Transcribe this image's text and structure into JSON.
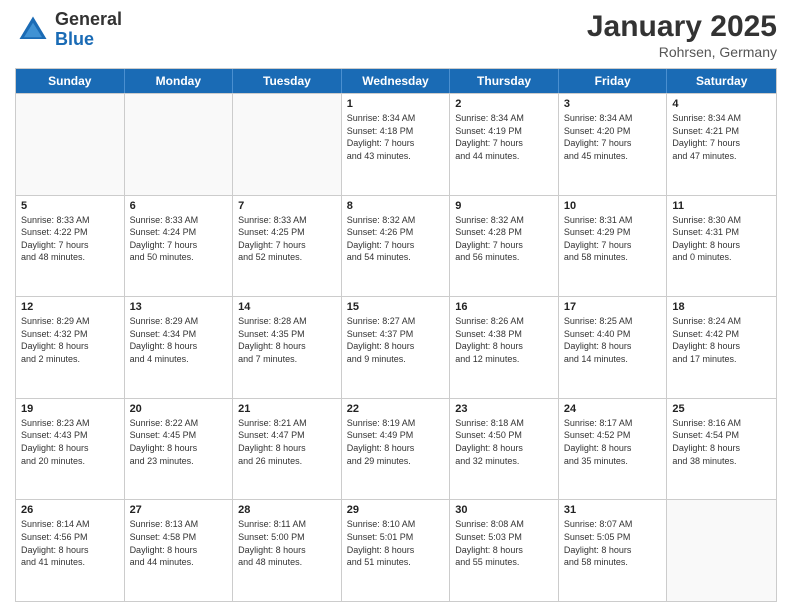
{
  "logo": {
    "general": "General",
    "blue": "Blue"
  },
  "title": "January 2025",
  "subtitle": "Rohrsen, Germany",
  "days": [
    "Sunday",
    "Monday",
    "Tuesday",
    "Wednesday",
    "Thursday",
    "Friday",
    "Saturday"
  ],
  "rows": [
    [
      {
        "day": "",
        "info": ""
      },
      {
        "day": "",
        "info": ""
      },
      {
        "day": "",
        "info": ""
      },
      {
        "day": "1",
        "info": "Sunrise: 8:34 AM\nSunset: 4:18 PM\nDaylight: 7 hours\nand 43 minutes."
      },
      {
        "day": "2",
        "info": "Sunrise: 8:34 AM\nSunset: 4:19 PM\nDaylight: 7 hours\nand 44 minutes."
      },
      {
        "day": "3",
        "info": "Sunrise: 8:34 AM\nSunset: 4:20 PM\nDaylight: 7 hours\nand 45 minutes."
      },
      {
        "day": "4",
        "info": "Sunrise: 8:34 AM\nSunset: 4:21 PM\nDaylight: 7 hours\nand 47 minutes."
      }
    ],
    [
      {
        "day": "5",
        "info": "Sunrise: 8:33 AM\nSunset: 4:22 PM\nDaylight: 7 hours\nand 48 minutes."
      },
      {
        "day": "6",
        "info": "Sunrise: 8:33 AM\nSunset: 4:24 PM\nDaylight: 7 hours\nand 50 minutes."
      },
      {
        "day": "7",
        "info": "Sunrise: 8:33 AM\nSunset: 4:25 PM\nDaylight: 7 hours\nand 52 minutes."
      },
      {
        "day": "8",
        "info": "Sunrise: 8:32 AM\nSunset: 4:26 PM\nDaylight: 7 hours\nand 54 minutes."
      },
      {
        "day": "9",
        "info": "Sunrise: 8:32 AM\nSunset: 4:28 PM\nDaylight: 7 hours\nand 56 minutes."
      },
      {
        "day": "10",
        "info": "Sunrise: 8:31 AM\nSunset: 4:29 PM\nDaylight: 7 hours\nand 58 minutes."
      },
      {
        "day": "11",
        "info": "Sunrise: 8:30 AM\nSunset: 4:31 PM\nDaylight: 8 hours\nand 0 minutes."
      }
    ],
    [
      {
        "day": "12",
        "info": "Sunrise: 8:29 AM\nSunset: 4:32 PM\nDaylight: 8 hours\nand 2 minutes."
      },
      {
        "day": "13",
        "info": "Sunrise: 8:29 AM\nSunset: 4:34 PM\nDaylight: 8 hours\nand 4 minutes."
      },
      {
        "day": "14",
        "info": "Sunrise: 8:28 AM\nSunset: 4:35 PM\nDaylight: 8 hours\nand 7 minutes."
      },
      {
        "day": "15",
        "info": "Sunrise: 8:27 AM\nSunset: 4:37 PM\nDaylight: 8 hours\nand 9 minutes."
      },
      {
        "day": "16",
        "info": "Sunrise: 8:26 AM\nSunset: 4:38 PM\nDaylight: 8 hours\nand 12 minutes."
      },
      {
        "day": "17",
        "info": "Sunrise: 8:25 AM\nSunset: 4:40 PM\nDaylight: 8 hours\nand 14 minutes."
      },
      {
        "day": "18",
        "info": "Sunrise: 8:24 AM\nSunset: 4:42 PM\nDaylight: 8 hours\nand 17 minutes."
      }
    ],
    [
      {
        "day": "19",
        "info": "Sunrise: 8:23 AM\nSunset: 4:43 PM\nDaylight: 8 hours\nand 20 minutes."
      },
      {
        "day": "20",
        "info": "Sunrise: 8:22 AM\nSunset: 4:45 PM\nDaylight: 8 hours\nand 23 minutes."
      },
      {
        "day": "21",
        "info": "Sunrise: 8:21 AM\nSunset: 4:47 PM\nDaylight: 8 hours\nand 26 minutes."
      },
      {
        "day": "22",
        "info": "Sunrise: 8:19 AM\nSunset: 4:49 PM\nDaylight: 8 hours\nand 29 minutes."
      },
      {
        "day": "23",
        "info": "Sunrise: 8:18 AM\nSunset: 4:50 PM\nDaylight: 8 hours\nand 32 minutes."
      },
      {
        "day": "24",
        "info": "Sunrise: 8:17 AM\nSunset: 4:52 PM\nDaylight: 8 hours\nand 35 minutes."
      },
      {
        "day": "25",
        "info": "Sunrise: 8:16 AM\nSunset: 4:54 PM\nDaylight: 8 hours\nand 38 minutes."
      }
    ],
    [
      {
        "day": "26",
        "info": "Sunrise: 8:14 AM\nSunset: 4:56 PM\nDaylight: 8 hours\nand 41 minutes."
      },
      {
        "day": "27",
        "info": "Sunrise: 8:13 AM\nSunset: 4:58 PM\nDaylight: 8 hours\nand 44 minutes."
      },
      {
        "day": "28",
        "info": "Sunrise: 8:11 AM\nSunset: 5:00 PM\nDaylight: 8 hours\nand 48 minutes."
      },
      {
        "day": "29",
        "info": "Sunrise: 8:10 AM\nSunset: 5:01 PM\nDaylight: 8 hours\nand 51 minutes."
      },
      {
        "day": "30",
        "info": "Sunrise: 8:08 AM\nSunset: 5:03 PM\nDaylight: 8 hours\nand 55 minutes."
      },
      {
        "day": "31",
        "info": "Sunrise: 8:07 AM\nSunset: 5:05 PM\nDaylight: 8 hours\nand 58 minutes."
      },
      {
        "day": "",
        "info": ""
      }
    ]
  ]
}
